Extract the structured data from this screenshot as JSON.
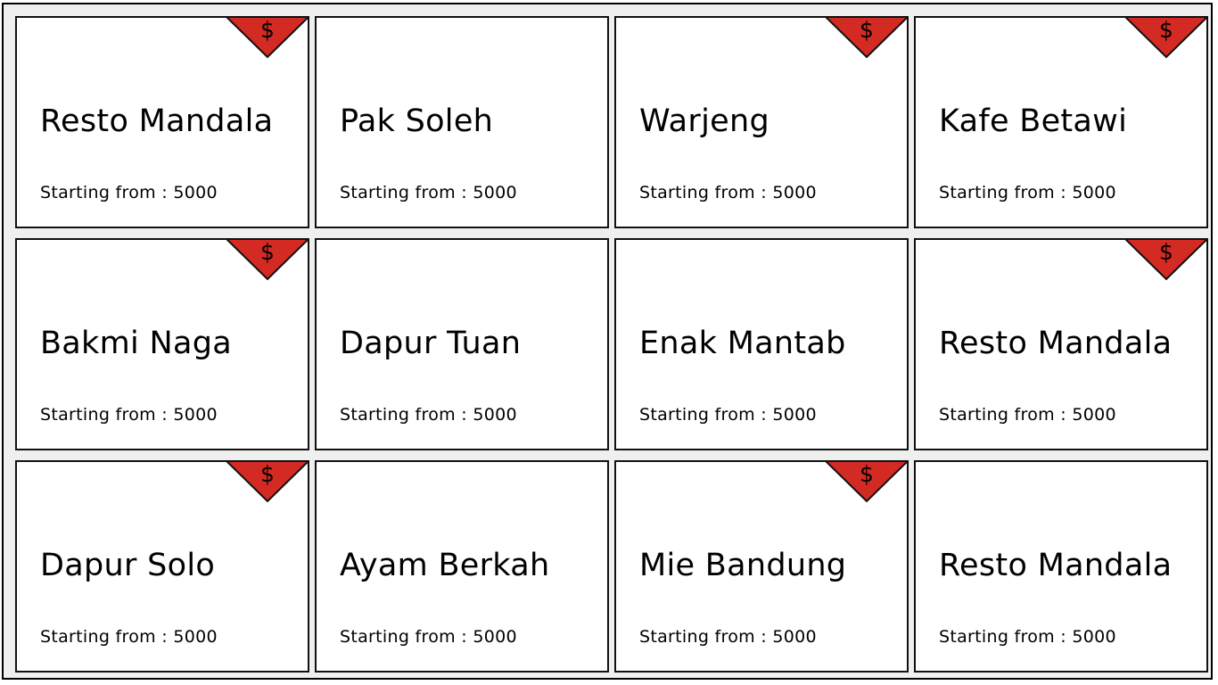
{
  "promo_badge": {
    "symbol": "$",
    "color": "#d42a24",
    "icon": "dollar-icon"
  },
  "restaurants": [
    {
      "name": "Resto Mandala",
      "price_text": "Starting from : 5000",
      "promo": true
    },
    {
      "name": "Pak Soleh",
      "price_text": "Starting from : 5000",
      "promo": false
    },
    {
      "name": "Warjeng",
      "price_text": "Starting from : 5000",
      "promo": true
    },
    {
      "name": "Kafe Betawi",
      "price_text": "Starting from : 5000",
      "promo": true
    },
    {
      "name": "Bakmi Naga",
      "price_text": "Starting from : 5000",
      "promo": true
    },
    {
      "name": "Dapur Tuan",
      "price_text": "Starting from : 5000",
      "promo": false
    },
    {
      "name": "Enak Mantab",
      "price_text": "Starting from : 5000",
      "promo": false
    },
    {
      "name": "Resto Mandala",
      "price_text": "Starting from : 5000",
      "promo": true
    },
    {
      "name": "Dapur Solo",
      "price_text": "Starting from : 5000",
      "promo": true
    },
    {
      "name": "Ayam Berkah",
      "price_text": "Starting from : 5000",
      "promo": false
    },
    {
      "name": "Mie Bandung",
      "price_text": "Starting from : 5000",
      "promo": true
    },
    {
      "name": "Resto Mandala",
      "price_text": "Starting from : 5000",
      "promo": false
    }
  ]
}
